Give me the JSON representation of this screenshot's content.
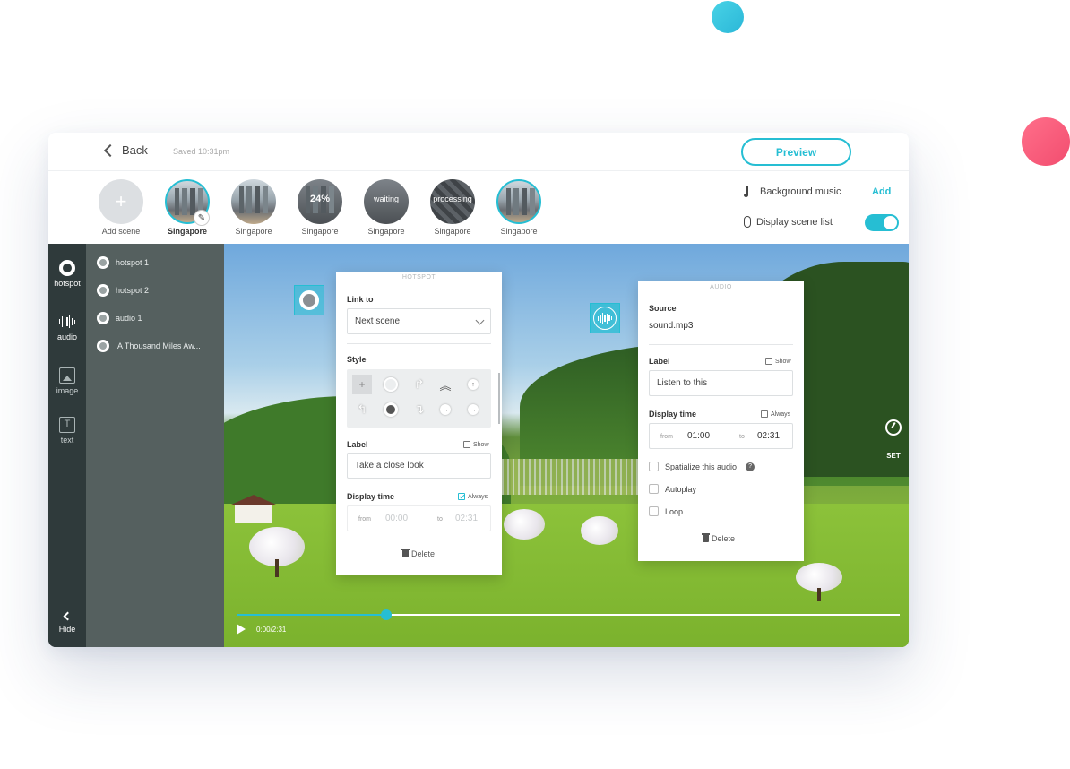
{
  "topbar": {
    "back_label": "Back",
    "saved_text": "Saved 10:31pm",
    "preview_label": "Preview"
  },
  "scenes": {
    "add_label": "Add scene",
    "add_icon": "plus-icon",
    "items": [
      {
        "label": "Singapore",
        "overlay": "",
        "state": "current"
      },
      {
        "label": "Singapore",
        "overlay": ""
      },
      {
        "label": "Singapore",
        "overlay": "24%"
      },
      {
        "label": "Singapore",
        "overlay": "waiting"
      },
      {
        "label": "Singapore",
        "overlay": "processing"
      },
      {
        "label": "Singapore",
        "overlay": ""
      }
    ]
  },
  "settings": {
    "bg_music_label": "Background music",
    "bg_music_action": "Add",
    "display_list_label": "Display scene list",
    "display_list_on": true
  },
  "tools": {
    "hotspot": "hotspot",
    "audio": "audio",
    "image": "image",
    "text": "text",
    "text_glyph": "T",
    "hide": "Hide"
  },
  "items_list": [
    "hotspot 1",
    "hotspot 2",
    "audio 1",
    "A Thousand Miles Aw..."
  ],
  "hotspot_panel": {
    "title": "HOTSPOT",
    "link_to_label": "Link to",
    "link_to_value": "Next scene",
    "style_label": "Style",
    "label_label": "Label",
    "label_show": "Show",
    "label_show_checked": false,
    "label_value": "Take a close look",
    "display_time_label": "Display time",
    "always_label": "Always",
    "always_checked": true,
    "from_label": "from",
    "from_value": "00:00",
    "to_label": "to",
    "to_value": "02:31",
    "delete_label": "Delete"
  },
  "audio_panel": {
    "title": "AUDIO",
    "source_label": "Source",
    "source_value": "sound.mp3",
    "label_label": "Label",
    "label_show": "Show",
    "label_value": "Listen to this",
    "display_time_label": "Display time",
    "always_label": "Always",
    "from_label": "from",
    "from_value": "01:00",
    "to_label": "to",
    "to_value": "02:31",
    "spatialize_label": "Spatialize this audio",
    "help_glyph": "?",
    "autoplay_label": "Autoplay",
    "loop_label": "Loop",
    "delete_label": "Delete"
  },
  "player": {
    "timecode": "0:00/2:31",
    "progress": 0.226
  },
  "set_label": "SET",
  "colors": {
    "accent": "#26bed3",
    "rail": "#2f3a3b",
    "list": "#55605f"
  }
}
